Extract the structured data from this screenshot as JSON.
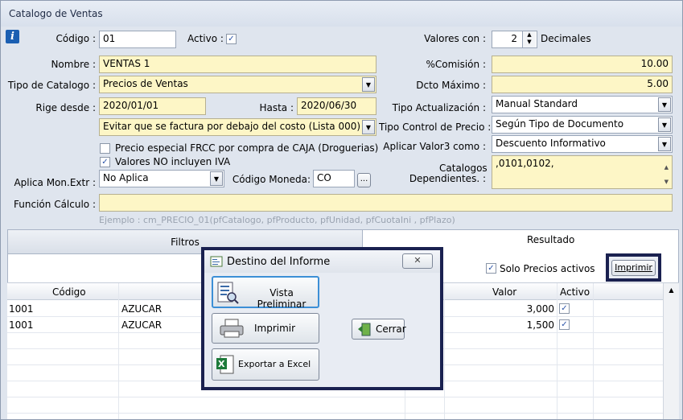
{
  "window": {
    "title": "Catalogo de Ventas"
  },
  "form": {
    "codigo_label": "Código :",
    "codigo_value": "01",
    "activo_label": "Activo :",
    "valores_con_label": "Valores con :",
    "decimales_value": "2",
    "decimales_label": "Decimales",
    "nombre_label": "Nombre :",
    "nombre_value": "VENTAS 1",
    "comision_label": "%Comisión :",
    "comision_value": "10.00",
    "tipo_catalogo_label": "Tipo de Catalogo :",
    "tipo_catalogo_value": "Precios de Ventas",
    "dcto_maximo_label": "Dcto Máximo :",
    "dcto_maximo_value": "5.00",
    "rige_desde_label": "Rige desde :",
    "rige_desde_value": "2020/01/01",
    "hasta_label": "Hasta :",
    "hasta_value": "2020/06/30",
    "tipo_actualizacion_label": "Tipo Actualización :",
    "tipo_actualizacion_value": "Manual Standard",
    "evitar_value": "Evitar que se factura por debajo del costo (Lista 000)",
    "tipo_control_label": "Tipo Control de Precio :",
    "tipo_control_value": "Según Tipo de Documento",
    "precio_especial_label": "Precio especial FRCC por compra de CAJA (Droguerias)",
    "aplicar_valor3_label": "Aplicar Valor3 como :",
    "aplicar_valor3_value": "Descuento Informativo",
    "valores_iva_label": "Valores NO incluyen IVA",
    "catalogos_dep_label_1": "Catalogos",
    "catalogos_dep_label_2": "Dependientes. :",
    "catalogos_dep_value": ",0101,0102,",
    "aplica_mon_label": "Aplica Mon.Extr :",
    "aplica_mon_value": "No Aplica",
    "codigo_moneda_label": "Código Moneda:",
    "codigo_moneda_value": "CO",
    "moneda_btn": "...",
    "funcion_calculo_label": "Función Cálculo :",
    "funcion_calculo_value": "",
    "ejemplo_hint": "Ejemplo : cm_PRECIO_01(pfCatalogo, pfProducto, pfUnidad, pfCuotaIni , pfPlazo)"
  },
  "tabs": {
    "filtros": "Filtros",
    "resultado": "Resultado"
  },
  "result": {
    "solo_precios_label": "Solo Precios activos",
    "imprimir_button": "Imprimir"
  },
  "grid": {
    "headers": {
      "codigo": "Código",
      "valor": "Valor",
      "activo": "Activo"
    },
    "rows": [
      {
        "codigo": "1001",
        "nombre": "AZUCAR",
        "valor": "3,000"
      },
      {
        "codigo": "1001",
        "nombre": "AZUCAR",
        "valor": "1,500"
      }
    ]
  },
  "dialog": {
    "title": "Destino del Informe",
    "vista_preliminar": "Vista Preliminar",
    "imprimir": "Imprimir",
    "cerrar": "Cerrar",
    "exportar_excel": "Exportar a Excel"
  }
}
